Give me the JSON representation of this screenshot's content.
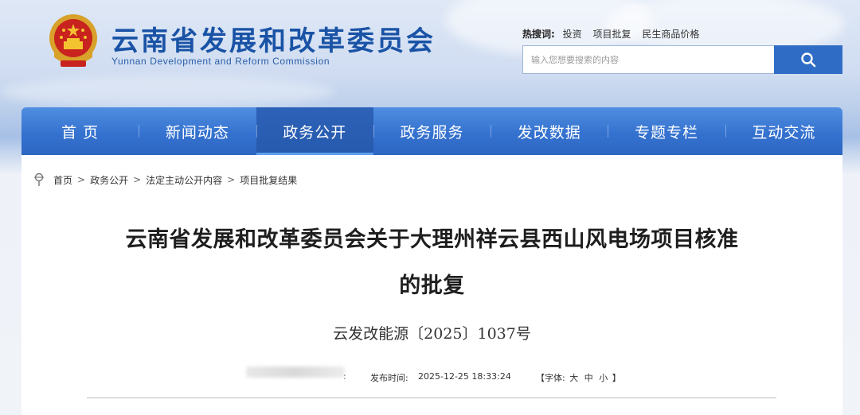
{
  "header": {
    "title": "云南省发展和改革委员会",
    "subtitle": "Yunnan Development and Reform Commission"
  },
  "hot_search": {
    "label": "热搜词:",
    "links": [
      "投资",
      "项目批复",
      "民生商品价格"
    ]
  },
  "search": {
    "placeholder": "输入您想要搜索的内容",
    "button_icon": "search-icon"
  },
  "nav": {
    "items": [
      "首 页",
      "新闻动态",
      "政务公开",
      "政务服务",
      "发改数据",
      "专题专栏",
      "互动交流"
    ],
    "active": "政务公开"
  },
  "breadcrumb": {
    "icon": "location-pin-icon",
    "items": [
      "首页",
      "政务公开",
      "法定主动公开内容",
      "项目批复结果"
    ],
    "separator": ">"
  },
  "article": {
    "title_line1": "云南省发展和改革委员会关于大理州祥云县西山风电场项目核准",
    "title_line2": "的批复",
    "doc_number": "云发改能源〔2025〕1037号",
    "publish_label": "发布时间:",
    "publish_time": "2025-12-25 18:33:24",
    "font_size_label": "【字体:",
    "font_sizes": [
      "大",
      "中",
      "小"
    ],
    "font_size_close": "】"
  },
  "colors": {
    "nav_blue": "#3572cf",
    "title_blue": "#1a53a6",
    "search_button": "#2f6cc5"
  }
}
